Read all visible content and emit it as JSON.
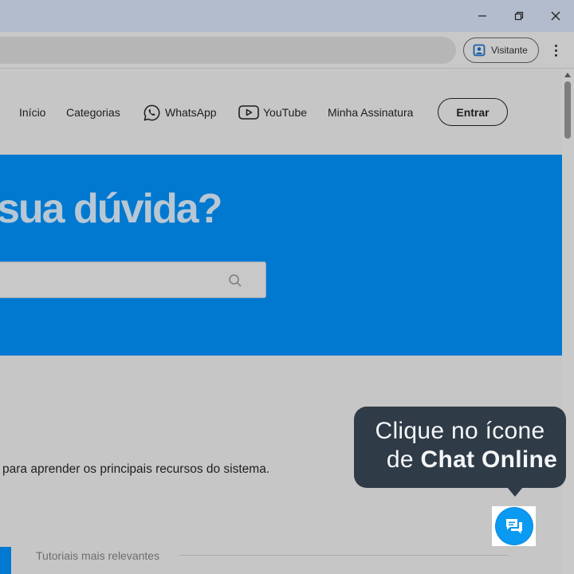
{
  "browser": {
    "profile_label": "Visitante"
  },
  "nav": {
    "items": [
      "Início",
      "Categorias",
      "WhatsApp",
      "YouTube",
      "Minha Assinatura"
    ],
    "login_label": "Entrar"
  },
  "hero": {
    "title": "sua dúvida?",
    "search_placeholder": ""
  },
  "content": {
    "description": "para aprender os principais recursos do sistema.",
    "section_label": "Tutoriais mais relevantes"
  },
  "tooltip": {
    "line1": "Clique no ícone",
    "line2_prefix": "de ",
    "line2_bold": "Chat Online"
  },
  "colors": {
    "hero_blue": "#0279d0",
    "bubble_bg": "#2f3b47",
    "chat_blue": "#0a9af2"
  },
  "icons": [
    "minimize-icon",
    "restore-icon",
    "close-icon",
    "profile-icon",
    "menu-icon",
    "whatsapp-icon",
    "youtube-icon",
    "search-icon",
    "chat-icon"
  ]
}
